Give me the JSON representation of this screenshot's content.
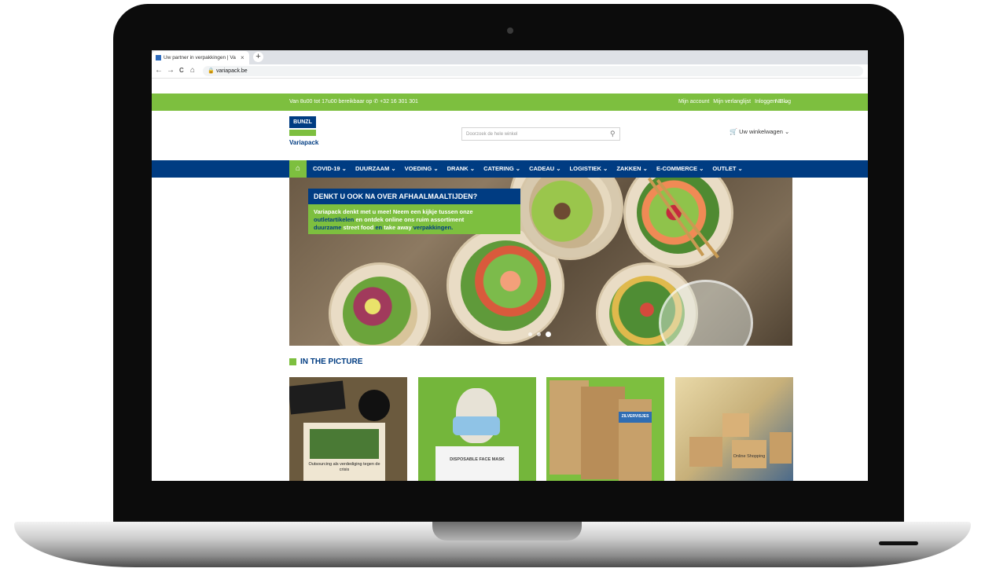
{
  "browser": {
    "tab_title": "Uw partner in verpakkingen | Variapack",
    "tab_close": "×",
    "new_tab": "+",
    "nav_icons": [
      "back-icon",
      "forward-icon",
      "reload-icon",
      "home-icon"
    ],
    "back": "←",
    "forward": "→",
    "reload": "C",
    "home": "⌂",
    "lock": "🔒",
    "url": "variapack.be"
  },
  "site": {
    "colors": {
      "green": "#7dbf3f",
      "blue": "#003c82"
    },
    "topbar": {
      "phone_text": "Van 8u00 tot 17u00 bereikbaar op ✆ +32 16 301 301",
      "links": [
        "Mijn account",
        "Mijn verlanglijst",
        "Inloggen",
        "Blog"
      ],
      "lang": "NL ⌄"
    },
    "logo": {
      "brand": "BUNZL",
      "name": "Variapack"
    },
    "search": {
      "placeholder": "Doorzoek de hele winkel",
      "icon": "⚲"
    },
    "cart": {
      "label": "Uw winkelwagen ⌄",
      "icon": "🛒"
    },
    "home_icon": "⌂",
    "menu": [
      "COVID-19 ⌄",
      "DUURZAAM ⌄",
      "VOEDING ⌄",
      "DRANK ⌄",
      "CATERING ⌄",
      "CADEAU ⌄",
      "LOGISTIEK ⌄",
      "ZAKKEN ⌄",
      "E-COMMERCE ⌄",
      "OUTLET ⌄"
    ],
    "hero": {
      "title": "DENKT U OOK NA OVER AFHAALMAALTIJDEN?",
      "text_1": "Variapack denkt met u mee! Neem een kijkje tussen onze",
      "link_1": "outletartikelen",
      "text_2": " en ontdek online ons ruim assortiment",
      "link_2": "duurzame",
      "text_3": " street food ",
      "link_3": "en",
      "text_4": " take away ",
      "link_4": "verpakkingen.",
      "slides": 3,
      "active_slide": 3
    },
    "section": {
      "title": "IN THE PICTURE"
    },
    "cards": [
      {
        "caption": "Outsourcing als verdediging tegen de crisis"
      },
      {
        "caption": "DISPOSABLE FACE MASK"
      },
      {
        "caption": "ZILVERVISJES"
      },
      {
        "caption": "Online Shopping"
      }
    ]
  }
}
